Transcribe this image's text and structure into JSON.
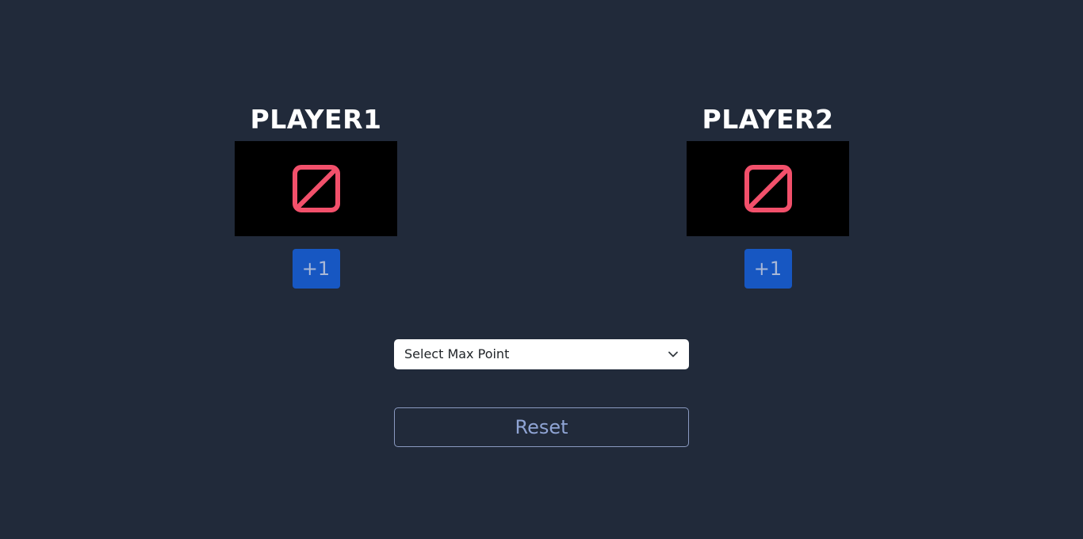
{
  "players": [
    {
      "name": "PLAYER1",
      "display_icon": "slashed-square-icon",
      "increment_label": "+1"
    },
    {
      "name": "PLAYER2",
      "display_icon": "slashed-square-icon",
      "increment_label": "+1"
    }
  ],
  "max_point_select": {
    "selected": "Select Max Point",
    "icon": "chevron-down-icon"
  },
  "reset_label": "Reset",
  "colors": {
    "background": "#212a3a",
    "display_background": "#000000",
    "icon_color": "#f2506b",
    "increment_button": "#1757c2",
    "reset_border": "#8a9ac0",
    "reset_text": "#8fa4d4"
  }
}
